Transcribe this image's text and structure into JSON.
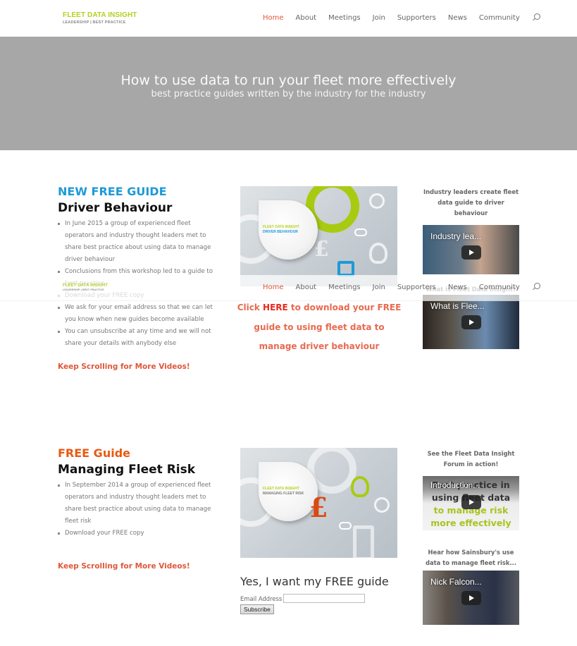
{
  "header": {
    "logo_line1": "FLEET DATA INSIGHT",
    "logo_line2": "LEADERSHIP | BEST PRACTICE",
    "nav": [
      {
        "label": "Home",
        "active": true
      },
      {
        "label": "About"
      },
      {
        "label": "Meetings"
      },
      {
        "label": "Join"
      },
      {
        "label": "Supporters"
      },
      {
        "label": "News"
      },
      {
        "label": "Community"
      }
    ],
    "search_icon": "search-icon"
  },
  "hero": {
    "title": "How to use data to run your fleet more effectively",
    "subtitle": "best practice guides written by the industry for the industry"
  },
  "section1": {
    "kicker": "NEW FREE GUIDE",
    "title": "Driver Behaviour",
    "bullets": [
      "In June 2015 a group of experienced fleet operators and industry thought leaders met to share best practice about using data to manage driver behaviour",
      "Conclusions from this workshop led to a guide to best practice",
      "Download your FREE copy",
      "We ask for your email address so that we can let you know when new guides become available",
      "You can unsubscribe at any time and we will not share your details with anybody else"
    ],
    "keep_scrolling": "Keep Scrolling for More Videos!",
    "cover": {
      "brand": "FLEET DATA INSIGHT",
      "topic": "DRIVER BEHAVIOUR"
    },
    "cta": {
      "prefix": "Click ",
      "link": "HERE",
      "suffix": " to download your FREE guide to using fleet data to manage driver behaviour"
    },
    "side": [
      {
        "caption": "Industry leaders create fleet data guide to driver behaviour",
        "video_title": "Industry lea..."
      },
      {
        "caption": "What is Fleet Data Insight?",
        "video_title": "What is Flee..."
      }
    ]
  },
  "section2": {
    "kicker": "FREE Guide",
    "title": "Managing Fleet Risk",
    "bullets": [
      "In September 2014 a group of experienced fleet operators and industry thought leaders met to share best practice about using data to manage fleet risk",
      "Download your FREE copy"
    ],
    "keep_scrolling": "Keep Scrolling for More Videos!",
    "cover": {
      "brand": "FLEET DATA INSIGHT",
      "topic": "MANAGING FLEET RISK"
    },
    "form": {
      "title": "Yes, I want my FREE guide",
      "email_label": "Email Address",
      "email_value": "",
      "subscribe_label": "Subscribe"
    },
    "side": [
      {
        "caption": "See the Fleet Data Insight Forum in action!",
        "video_title": "Introduction...",
        "thumb_line1": "Best practice in",
        "thumb_line2": "using fleet data",
        "thumb_line3": "to manage risk",
        "thumb_line4": "more effectively"
      },
      {
        "caption": "Hear how Sainsbury's use data to manage fleet risk...",
        "video_title": "Nick Falcon..."
      }
    ]
  },
  "colors": {
    "accent": "#e0573a",
    "kicker_blue": "#1e9ad6",
    "kicker_orange": "#e85a12",
    "brand_green": "#b7cf1f",
    "hero_bg": "#a7a7a7"
  }
}
